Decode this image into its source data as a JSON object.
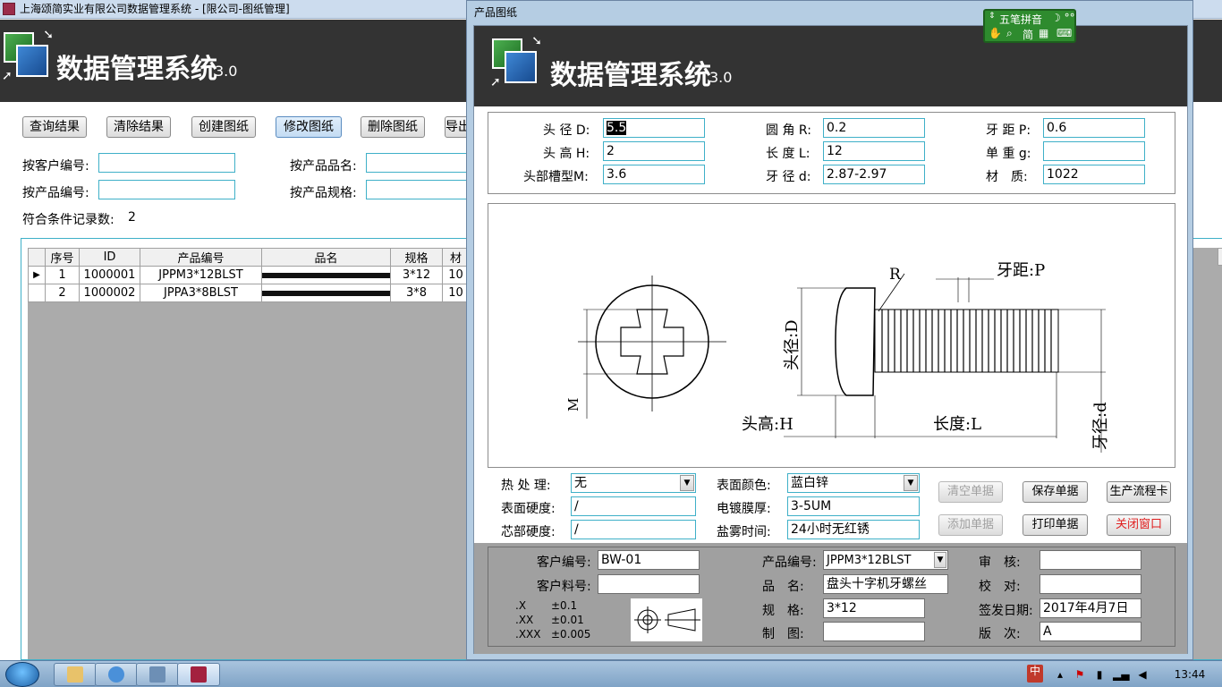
{
  "main": {
    "title": "上海颂简实业有限公司数据管理系统 - [限公司-图纸管理]",
    "banner_title": "数据管理系统",
    "version": "3.0",
    "buttons": {
      "query": "查询结果",
      "clear": "清除结果",
      "create": "创建图纸",
      "modify": "修改图纸",
      "delete": "删除图纸",
      "export": "导出"
    },
    "filters": {
      "customer_no_label": "按客户编号:",
      "product_no_label": "按产品编号:",
      "product_name_label": "按产品品名:",
      "product_spec_label": "按产品规格:"
    },
    "record_count_label": "符合条件记录数:",
    "record_count": "2",
    "table": {
      "headers": [
        "序号",
        "ID",
        "产品编号",
        "品名",
        "规格",
        "材"
      ],
      "rows": [
        {
          "seq": "1",
          "id": "1000001",
          "product_no": "JPPM3*12BLST",
          "name": "",
          "spec": "3*12",
          "mat": "10"
        },
        {
          "seq": "2",
          "id": "1000002",
          "product_no": "JPPA3*8BLST",
          "name": "",
          "spec": "3*8",
          "mat": "10"
        }
      ]
    }
  },
  "popup": {
    "title": "产品图纸",
    "banner_title": "数据管理系统",
    "version": "3.0",
    "dims": {
      "head_dia_label": "头 径 D:",
      "head_dia": "5.5",
      "head_h_label": "头 高 H:",
      "head_h": "2",
      "slot_label": "头部槽型M:",
      "slot": "3.6",
      "radius_label": "圆 角 R:",
      "radius": "0.2",
      "length_label": "长 度 L:",
      "length": "12",
      "thread_dia_label": "牙 径 d:",
      "thread_dia": "2.87-2.97",
      "pitch_label": "牙 距 P:",
      "pitch": "0.6",
      "unit_weight_label": "单 重 g:",
      "unit_weight": "",
      "material_label": "材　质:",
      "material": "1022"
    },
    "drawing": {
      "label_m": "M",
      "label_d": "头径:D",
      "label_r": "R",
      "label_p": "牙距:P",
      "label_h": "头高:H",
      "label_l": "长度:L",
      "label_thread": "牙径:d"
    },
    "process": {
      "heat_label": "热 处 理:",
      "heat": "无",
      "surface_hard_label": "表面硬度:",
      "surface_hard": "/",
      "core_hard_label": "芯部硬度:",
      "core_hard": "/",
      "color_label": "表面颜色:",
      "color": "蓝白锌",
      "plating_label": "电镀膜厚:",
      "plating": "3-5UM",
      "salt_label": "盐雾时间:",
      "salt": "24小时无红锈"
    },
    "actions": {
      "clear_form": "清空单据",
      "save_form": "保存单据",
      "process_card": "生产流程卡",
      "add_form": "添加单据",
      "print_form": "打印单据",
      "close_window": "关闭窗口"
    },
    "footer": {
      "customer_no_label": "客户编号:",
      "customer_no": "BW-01",
      "customer_part_label": "客户料号:",
      "customer_part": "",
      "product_no_label": "产品编号:",
      "product_no": "JPPM3*12BLST",
      "name_label": "品　名:",
      "name": "盘头十字机牙螺丝",
      "spec_label": "规　格:",
      "spec": "3*12",
      "drawn_label": "制　图:",
      "drawn": "",
      "audit_label": "审　核:",
      "audit": "",
      "check_label": "校　对:",
      "check": "",
      "issue_date_label": "签发日期:",
      "issue_date": "2017年4月7日",
      "revision_label": "版　次:",
      "revision": "A",
      "tolerances": [
        {
          "k": ".X",
          "v": "±0.1"
        },
        {
          "k": ".XX",
          "v": "±0.01"
        },
        {
          "k": ".XXX",
          "v": "±0.005"
        }
      ]
    }
  },
  "ime": {
    "row1": "五笔拼音",
    "row2": "简"
  },
  "taskbar": {
    "time": "13:44"
  },
  "colors": {
    "field_border": "#3fb0c8",
    "banner": "#333333",
    "danger": "#e02020"
  }
}
